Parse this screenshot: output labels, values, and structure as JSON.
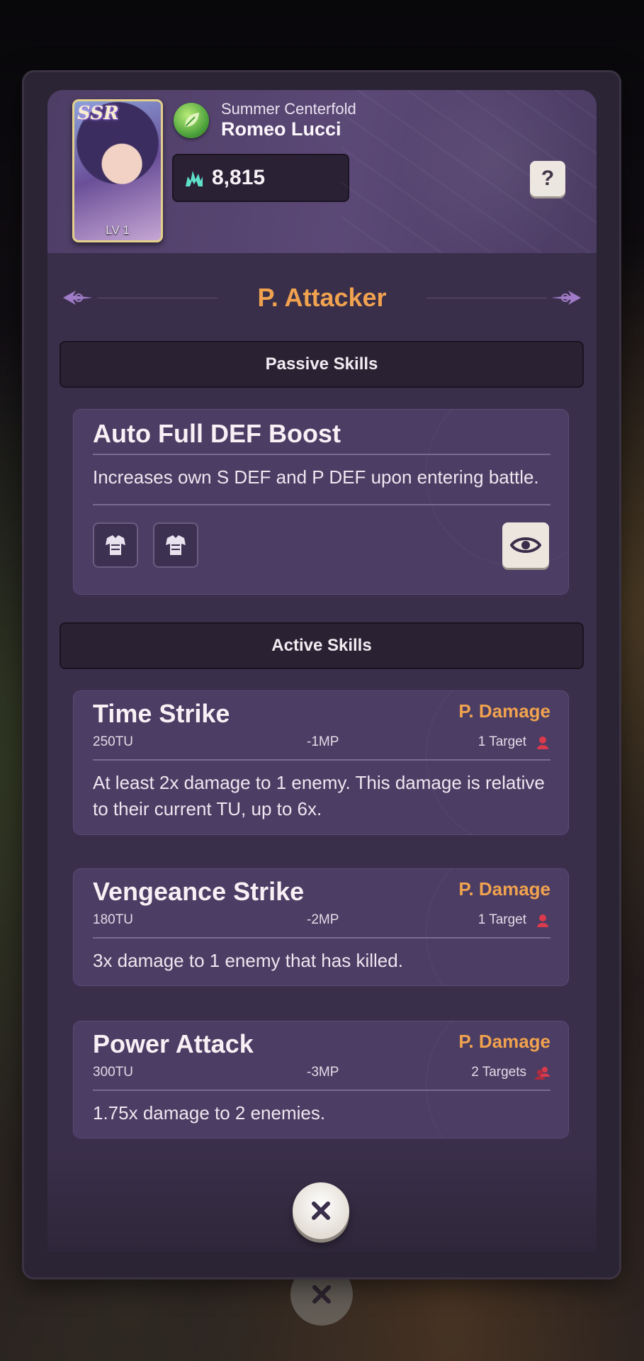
{
  "character": {
    "rarity": "SSR",
    "level": "LV 1",
    "subtitle": "Summer Centerfold",
    "name": "Romeo Lucci",
    "power": "8,815",
    "element": "leaf-icon",
    "help_label": "?"
  },
  "role": "P. Attacker",
  "passive": {
    "header": "Passive Skills",
    "skills": [
      {
        "name": "Auto Full DEF Boost",
        "description": "Increases own S DEF and P DEF upon entering battle.",
        "tags": [
          "armor-icon",
          "armor-icon"
        ]
      }
    ]
  },
  "active": {
    "header": "Active Skills",
    "skills": [
      {
        "name": "Time Strike",
        "damage_type": "P. Damage",
        "tu": "250TU",
        "mp": "-1MP",
        "targets": "1 Target",
        "description": "At least 2x damage to 1 enemy. This damage is relative to their current TU, up to 6x."
      },
      {
        "name": "Vengeance Strike",
        "damage_type": "P. Damage",
        "tu": "180TU",
        "mp": "-2MP",
        "targets": "1 Target",
        "description": "3x damage to 1 enemy that has killed."
      },
      {
        "name": "Power Attack",
        "damage_type": "P. Damage",
        "tu": "300TU",
        "mp": "-3MP",
        "targets": "2 Targets",
        "description": "1.75x damage to 2 enemies."
      }
    ]
  },
  "colors": {
    "accent_orange": "#f0a24f",
    "panel": "#3a2f4a",
    "card": "#4b3d63",
    "target_icon": "#d93a4c"
  }
}
